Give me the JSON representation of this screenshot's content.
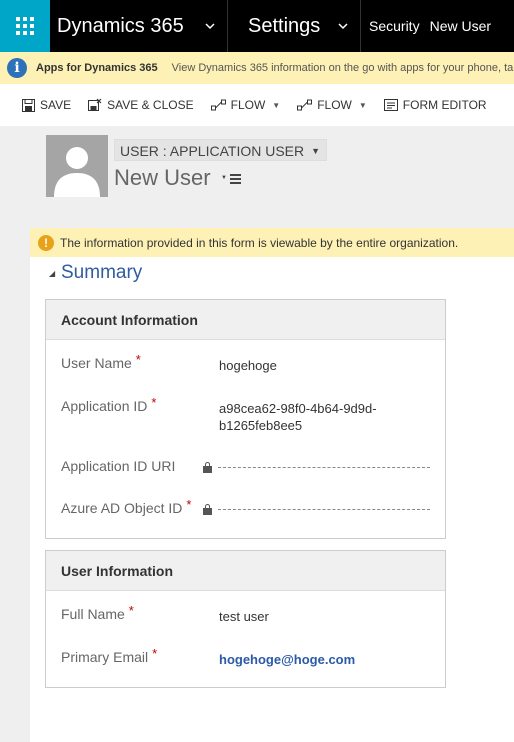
{
  "topnav": {
    "app_name": "Dynamics 365",
    "area": "Settings",
    "crumb_1": "Security",
    "crumb_2": "New User"
  },
  "apps_bar": {
    "title": "Apps for Dynamics 365",
    "message": "View Dynamics 365 information on the go with apps for your phone, ta"
  },
  "commands": {
    "save": "SAVE",
    "save_close": "SAVE & CLOSE",
    "flow_1": "FLOW",
    "flow_2": "FLOW",
    "form_editor": "FORM EDITOR"
  },
  "header": {
    "form_selector": "USER : APPLICATION USER",
    "record_title": "New User"
  },
  "notification": {
    "text": "The information provided in this form is viewable by the entire organization."
  },
  "summary": {
    "title": "Summary",
    "account_section": {
      "title": "Account Information",
      "user_name_label": "User Name",
      "user_name_value": "hogehoge",
      "app_id_label": "Application ID",
      "app_id_value": "a98cea62-98f0-4b64-9d9d-b1265feb8ee5",
      "app_id_uri_label": "Application ID URI",
      "azure_ad_label": "Azure AD Object ID"
    },
    "user_section": {
      "title": "User Information",
      "full_name_label": "Full Name",
      "full_name_value": "test user",
      "email_label": "Primary Email",
      "email_value": "hogehoge@hoge.com"
    },
    "required_marker": "*"
  },
  "colors": {
    "brand_teal": "#00a6c7",
    "nav_black": "#000000",
    "notice_yellow": "#fdf1b5",
    "link_blue": "#2a5aa8",
    "required_red": "#c00000"
  }
}
